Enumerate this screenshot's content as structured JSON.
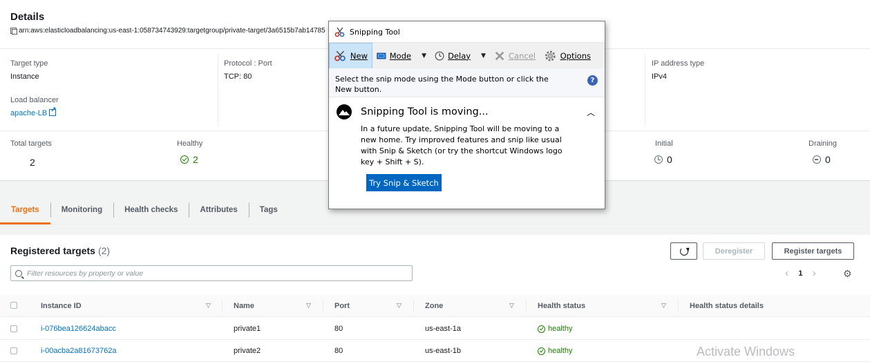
{
  "details": {
    "title": "Details",
    "arn": "arn:aws:elasticloadbalancing:us-east-1:058734743929:targetgroup/private-target/3a6515b7ab14785",
    "target_type_label": "Target type",
    "target_type_value": "Instance",
    "protocol_label": "Protocol : Port",
    "protocol_value": "TCP: 80",
    "ip_type_label": "IP address type",
    "ip_type_value": "IPv4",
    "lb_label": "Load balancer",
    "lb_value": "apache-LB",
    "total_label": "Total targets",
    "total_value": "2",
    "healthy_label": "Healthy",
    "healthy_value": "2",
    "initial_label": "Initial",
    "initial_value": "0",
    "draining_label": "Draining",
    "draining_value": "0"
  },
  "tabs": [
    {
      "label": "Targets",
      "active": true
    },
    {
      "label": "Monitoring",
      "active": false
    },
    {
      "label": "Health checks",
      "active": false
    },
    {
      "label": "Attributes",
      "active": false
    },
    {
      "label": "Tags",
      "active": false
    }
  ],
  "registered": {
    "title": "Registered targets",
    "count": "(2)",
    "deregister_label": "Deregister",
    "register_label": "Register targets",
    "search_placeholder": "Filter resources by property or value",
    "page": "1",
    "columns": [
      "Instance ID",
      "Name",
      "Port",
      "Zone",
      "Health status",
      "Health status details"
    ],
    "rows": [
      {
        "instance_id": "i-076bea126624abacc",
        "name": "private1",
        "port": "80",
        "zone": "us-east-1a",
        "health": "healthy",
        "details": ""
      },
      {
        "instance_id": "i-00acba2a81673762a",
        "name": "private2",
        "port": "80",
        "zone": "us-east-1b",
        "health": "healthy",
        "details": ""
      }
    ]
  },
  "snipping_tool": {
    "title": "Snipping Tool",
    "new_label": "New",
    "mode_label": "Mode",
    "delay_label": "Delay",
    "cancel_label": "Cancel",
    "options_label": "Options",
    "info_text": "Select the snip mode using the Mode button or click the New button.",
    "moving_title": "Snipping Tool is moving...",
    "moving_body": "In a future update, Snipping Tool will be moving to a new home. Try improved features and snip like usual with Snip & Sketch (or try the shortcut Windows logo key + Shift + S).",
    "try_button": "Try Snip & Sketch"
  },
  "watermark": "Activate Windows",
  "colors": {
    "accent_orange": "#ec7211",
    "link_blue": "#0073bb",
    "healthy_green": "#1d8102",
    "snip_button_blue": "#0067c0"
  }
}
